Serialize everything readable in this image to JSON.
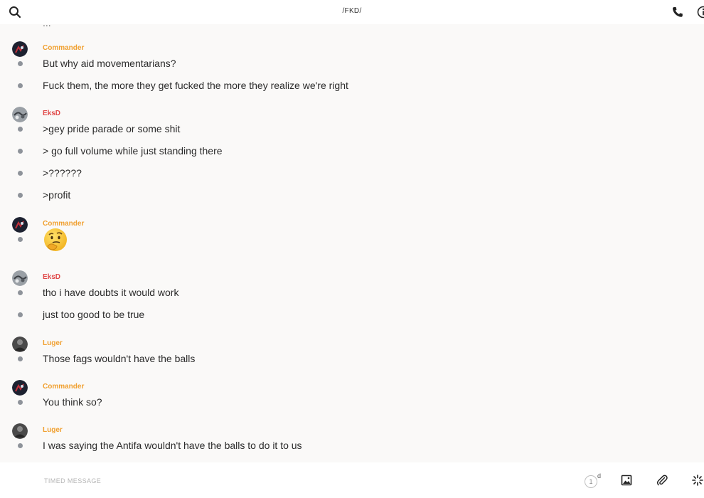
{
  "header": {
    "title": "/FKD/",
    "search_icon": "search-icon",
    "call_icon": "phone-icon",
    "info_icon": "info-icon"
  },
  "feed": {
    "cutoff_text": "...",
    "groups": [
      {
        "author": "Commander",
        "author_color": "#f0a030",
        "avatar": "avatar-commander",
        "messages": [
          "But why aid movementarians?",
          "Fuck them, the more they get fucked the more they realize we're right"
        ]
      },
      {
        "author": "EksD",
        "author_color": "#e04848",
        "avatar": "avatar-eksd",
        "messages": [
          ">gey pride parade or some shit",
          "> go full volume while just standing there",
          ">??????",
          ">profit"
        ]
      },
      {
        "author": "Commander",
        "author_color": "#f0a030",
        "avatar": "avatar-commander",
        "messages": [
          "thinking-face-emoji"
        ]
      },
      {
        "author": "EksD",
        "author_color": "#e04848",
        "avatar": "avatar-eksd",
        "messages": [
          "tho i have doubts it would work",
          "just too good to be true"
        ]
      },
      {
        "author": "Luger",
        "author_color": "#f0a030",
        "avatar": "avatar-luger",
        "messages": [
          "Those fags wouldn't have the balls"
        ]
      },
      {
        "author": "Commander",
        "author_color": "#f0a030",
        "avatar": "avatar-commander",
        "messages": [
          "You think so?"
        ]
      },
      {
        "author": "Luger",
        "author_color": "#f0a030",
        "avatar": "avatar-luger",
        "messages": [
          "I was saying the Antifa wouldn't have the balls to do it to us"
        ]
      }
    ]
  },
  "composer": {
    "placeholder": "TIMED MESSAGE",
    "value": "",
    "timer_value": "1",
    "timer_unit": "d",
    "image_icon": "image-icon",
    "attach_icon": "paperclip-icon",
    "giphy_icon": "sparkle-icon"
  }
}
